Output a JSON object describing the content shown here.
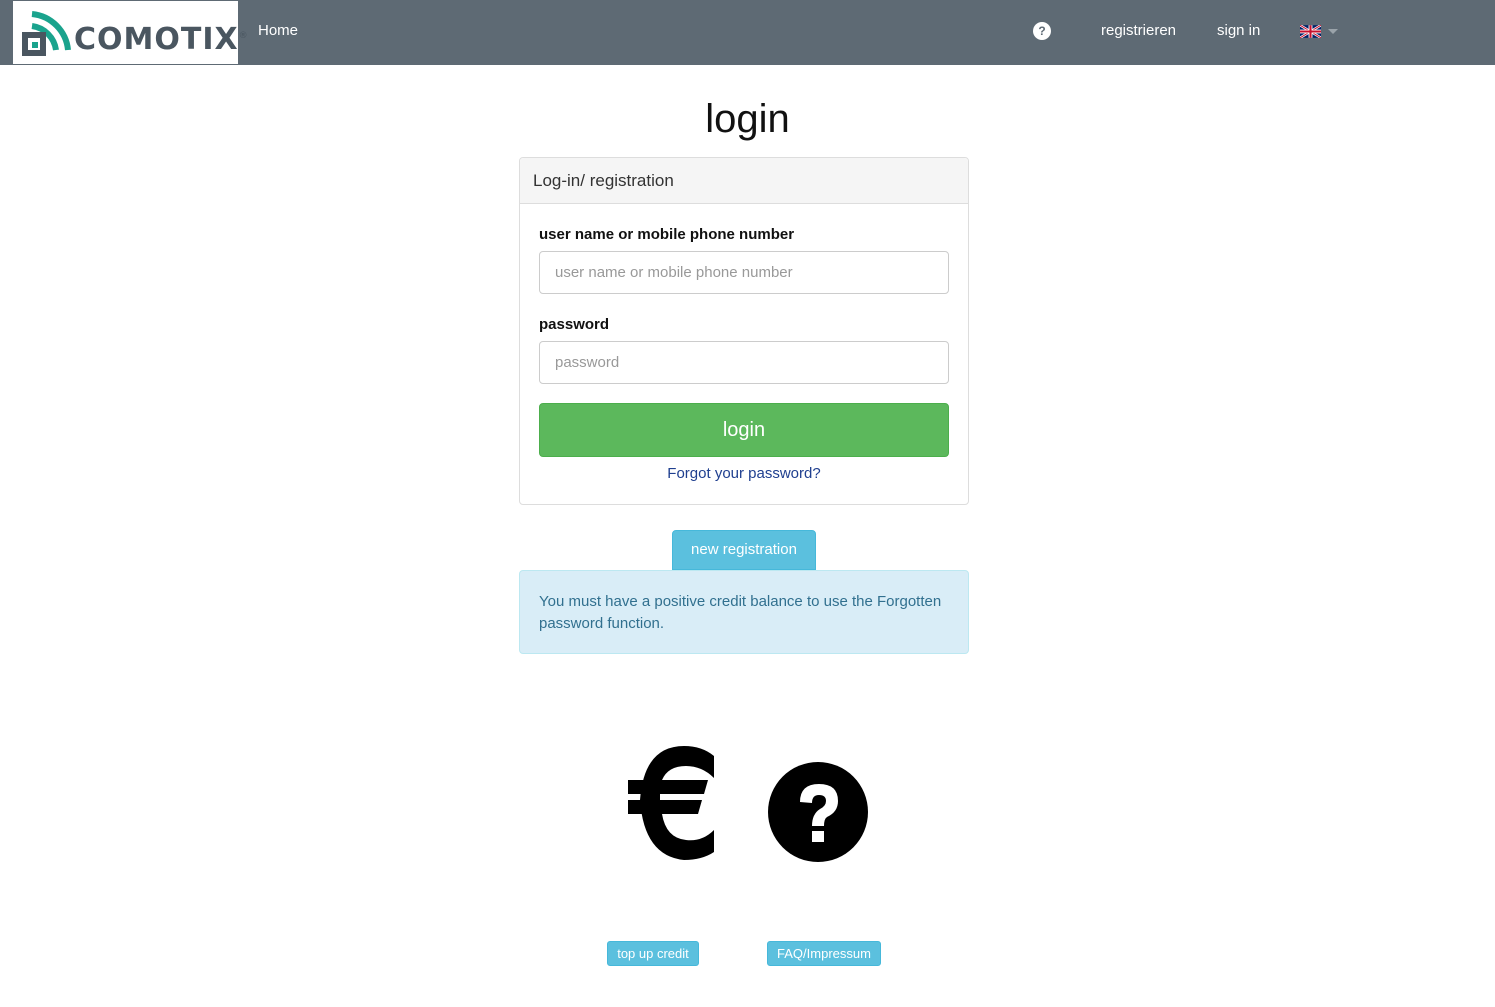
{
  "navbar": {
    "brand_text": "COMOTIX",
    "brand_mark": "®",
    "home": "Home",
    "help_glyph": "?",
    "help_icon": "question-circle-icon",
    "register": "registrieren",
    "sign_in": "sign in",
    "language_icon": "uk-flag-icon"
  },
  "main": {
    "title": "login",
    "panel_heading": "Log-in/ registration",
    "username_label": "user name or mobile phone number",
    "username_placeholder": "user name or mobile phone number",
    "password_label": "password",
    "password_placeholder": "password",
    "login_button": "login",
    "forgot_link": "Forgot your password?",
    "new_registration": "new registration",
    "alert_text": "You must have a positive credit balance to use the Forgotten password function."
  },
  "footer": {
    "top_up_icon": "euro-icon",
    "top_up_label": "top up credit",
    "faq_icon": "question-circle-icon",
    "faq_label": "FAQ/Impressum"
  },
  "colors": {
    "navbar": "#5e6a74",
    "success": "#5cb85c",
    "info": "#5bc0de",
    "alert_bg": "#d9edf7",
    "alert_text": "#31708f",
    "logo_teal": "#1aa38d"
  }
}
